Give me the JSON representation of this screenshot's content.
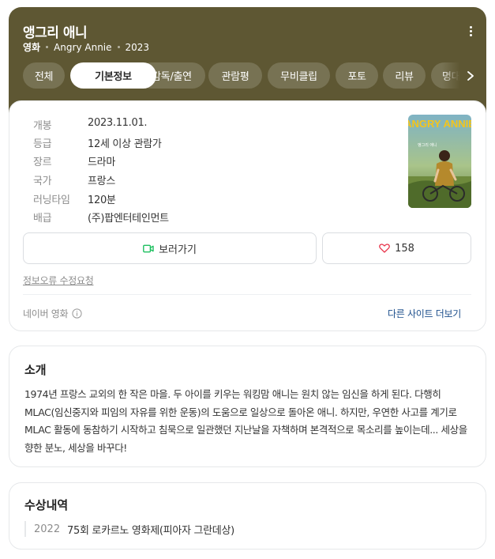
{
  "movie": {
    "title": "앵그리 애니",
    "genre": "영화",
    "original_title": "Angry Annie",
    "year": "2023"
  },
  "tabs": [
    "전체",
    "기본정보",
    "감독/출연",
    "관람평",
    "무비클립",
    "포토",
    "리뷰",
    "명대사"
  ],
  "active_tab": "기본정보",
  "info": [
    {
      "key": "개봉",
      "value": "2023.11.01."
    },
    {
      "key": "등급",
      "value": "12세 이상 관람가"
    },
    {
      "key": "장르",
      "value": "드라마"
    },
    {
      "key": "국가",
      "value": "프랑스"
    },
    {
      "key": "러닝타임",
      "value": "120분"
    },
    {
      "key": "배급",
      "value": "(주)팝엔터테인먼트"
    }
  ],
  "poster": {
    "title_text": "ANGRY ANNIE",
    "small_text": "앵그리 애니"
  },
  "actions": {
    "watch_label": "보러가기",
    "like_count": "158"
  },
  "report_link": "정보오류 수정요청",
  "source_label": "네이버 영화",
  "other_sites_label": "다른 사이트 더보기",
  "intro": {
    "title": "소개",
    "text": "1974년 프랑스 교외의 한 작은 마을. 두 아이를 키우는 워킹맘 애니는 원치 않는 임신을 하게 된다. 다행히 MLAC(임신중지와 피임의 자유를 위한 운동)의 도움으로 일상으로 돌아온 애니. 하지만, 우연한 사고를 계기로 MLAC 활동에 동참하기 시작하고 침묵으로 일관했던 지난날을 자책하며 본격적으로 목소리를 높이는데... 세상을 향한 분노, 세상을 바꾸다!"
  },
  "awards": {
    "title": "수상내역",
    "items": [
      {
        "year": "2022",
        "name": "75회 로카르노 영화제(피아자 그란데상)"
      }
    ]
  },
  "colors": {
    "header_bg": "#5e5733",
    "link": "#1d4f8c",
    "watch_icon": "#1fc060",
    "heart_icon": "#e8334a"
  }
}
